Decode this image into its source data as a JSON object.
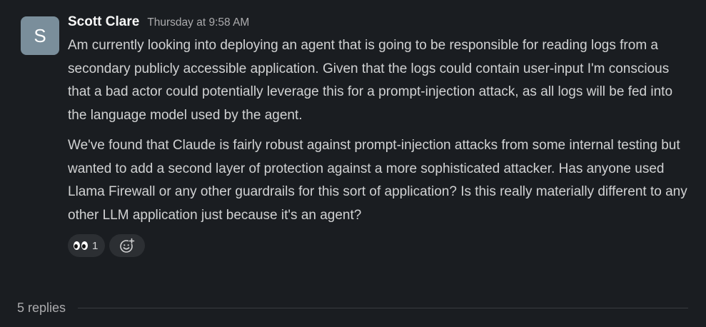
{
  "message": {
    "avatar_initial": "S",
    "author": "Scott Clare",
    "timestamp": "Thursday at 9:58 AM",
    "paragraphs": [
      "Am currently looking into deploying an agent that is going to be responsible for reading logs from a secondary publicly accessible application. Given that the logs could contain user-input I'm conscious that a bad actor could potentially leverage this for a prompt-injection attack, as all logs will be fed into the language model used by the agent.",
      "We've found that Claude is fairly robust against prompt-injection attacks from some internal testing but wanted to add a second layer of protection against a more sophisticated attacker. Has anyone used Llama Firewall or any other guardrails for this sort of application? Is this really materially different to any other LLM application just because it's an agent?"
    ],
    "reactions": [
      {
        "emoji": "eyes-emoji",
        "count": "1"
      }
    ],
    "add_reaction_icon": "add-reaction-icon"
  },
  "thread": {
    "replies_label": "5 replies"
  },
  "colors": {
    "background": "#1a1d21",
    "avatar_bg": "#7a8e9b",
    "text": "#d1d2d3",
    "muted": "#ababad",
    "author": "#f8f8f8",
    "pill_bg": "#2c2f33"
  }
}
